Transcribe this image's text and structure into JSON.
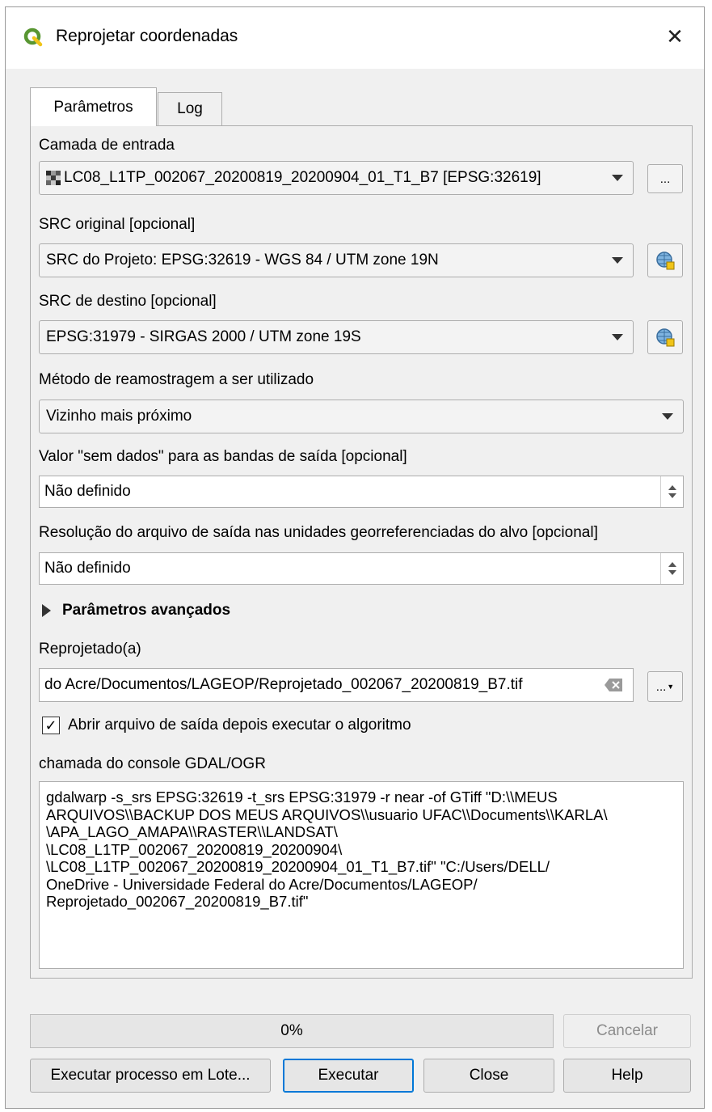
{
  "window": {
    "title": "Reprojetar coordenadas",
    "close_glyph": "✕"
  },
  "tabs": [
    {
      "label": "Parâmetros",
      "active": true
    },
    {
      "label": "Log",
      "active": false
    }
  ],
  "input_layer": {
    "label": "Camada de entrada",
    "value": "LC08_L1TP_002067_20200819_20200904_01_T1_B7 [EPSG:32619]",
    "browse_label": "..."
  },
  "source_crs": {
    "label": "SRC original [opcional]",
    "value": "SRC do Projeto: EPSG:32619 - WGS 84 / UTM zone 19N"
  },
  "target_crs": {
    "label": "SRC de destino [opcional]",
    "value": "EPSG:31979 - SIRGAS 2000 / UTM zone 19S"
  },
  "resampling": {
    "label": "Método de reamostragem a ser utilizado",
    "value": "Vizinho mais próximo"
  },
  "nodata": {
    "label": "Valor \"sem dados\" para as bandas de saída [opcional]",
    "value": "Não definido"
  },
  "resolution": {
    "label": "Resolução do arquivo de saída nas unidades georreferenciadas do alvo [opcional]",
    "value": "Não definido"
  },
  "advanced": {
    "label": "Parâmetros avançados",
    "expanded": false
  },
  "output": {
    "label": "Reprojetado(a)",
    "value": "do Acre/Documentos/LAGEOP/Reprojetado_002067_20200819_B7.tif",
    "browse_label": "..."
  },
  "open_output": {
    "label": "Abrir arquivo de saída depois executar o algoritmo",
    "checked": true
  },
  "console": {
    "label": "chamada do console GDAL/OGR",
    "lines": [
      "gdalwarp -s_srs EPSG:32619 -t_srs EPSG:31979 -r near -of GTiff \"D:\\\\MEUS",
      "ARQUIVOS\\\\BACKUP DOS MEUS ARQUIVOS\\\\usuario UFAC\\\\Documents\\\\KARLA\\",
      "\\APA_LAGO_AMAPA\\\\RASTER\\\\LANDSAT\\",
      "\\LC08_L1TP_002067_20200819_20200904\\",
      "\\LC08_L1TP_002067_20200819_20200904_01_T1_B7.tif\" \"C:/Users/DELL/",
      "OneDrive - Universidade Federal do Acre/Documentos/LAGEOP/",
      "Reprojetado_002067_20200819_B7.tif\""
    ]
  },
  "progress": {
    "text": "0%",
    "value": 0
  },
  "buttons": {
    "cancel": "Cancelar",
    "batch": "Executar processo em Lote...",
    "run": "Executar",
    "close": "Close",
    "help": "Help"
  },
  "colors": {
    "accent": "#0078d7",
    "qgis_green": "#589632",
    "qgis_yellow": "#f0c419"
  }
}
